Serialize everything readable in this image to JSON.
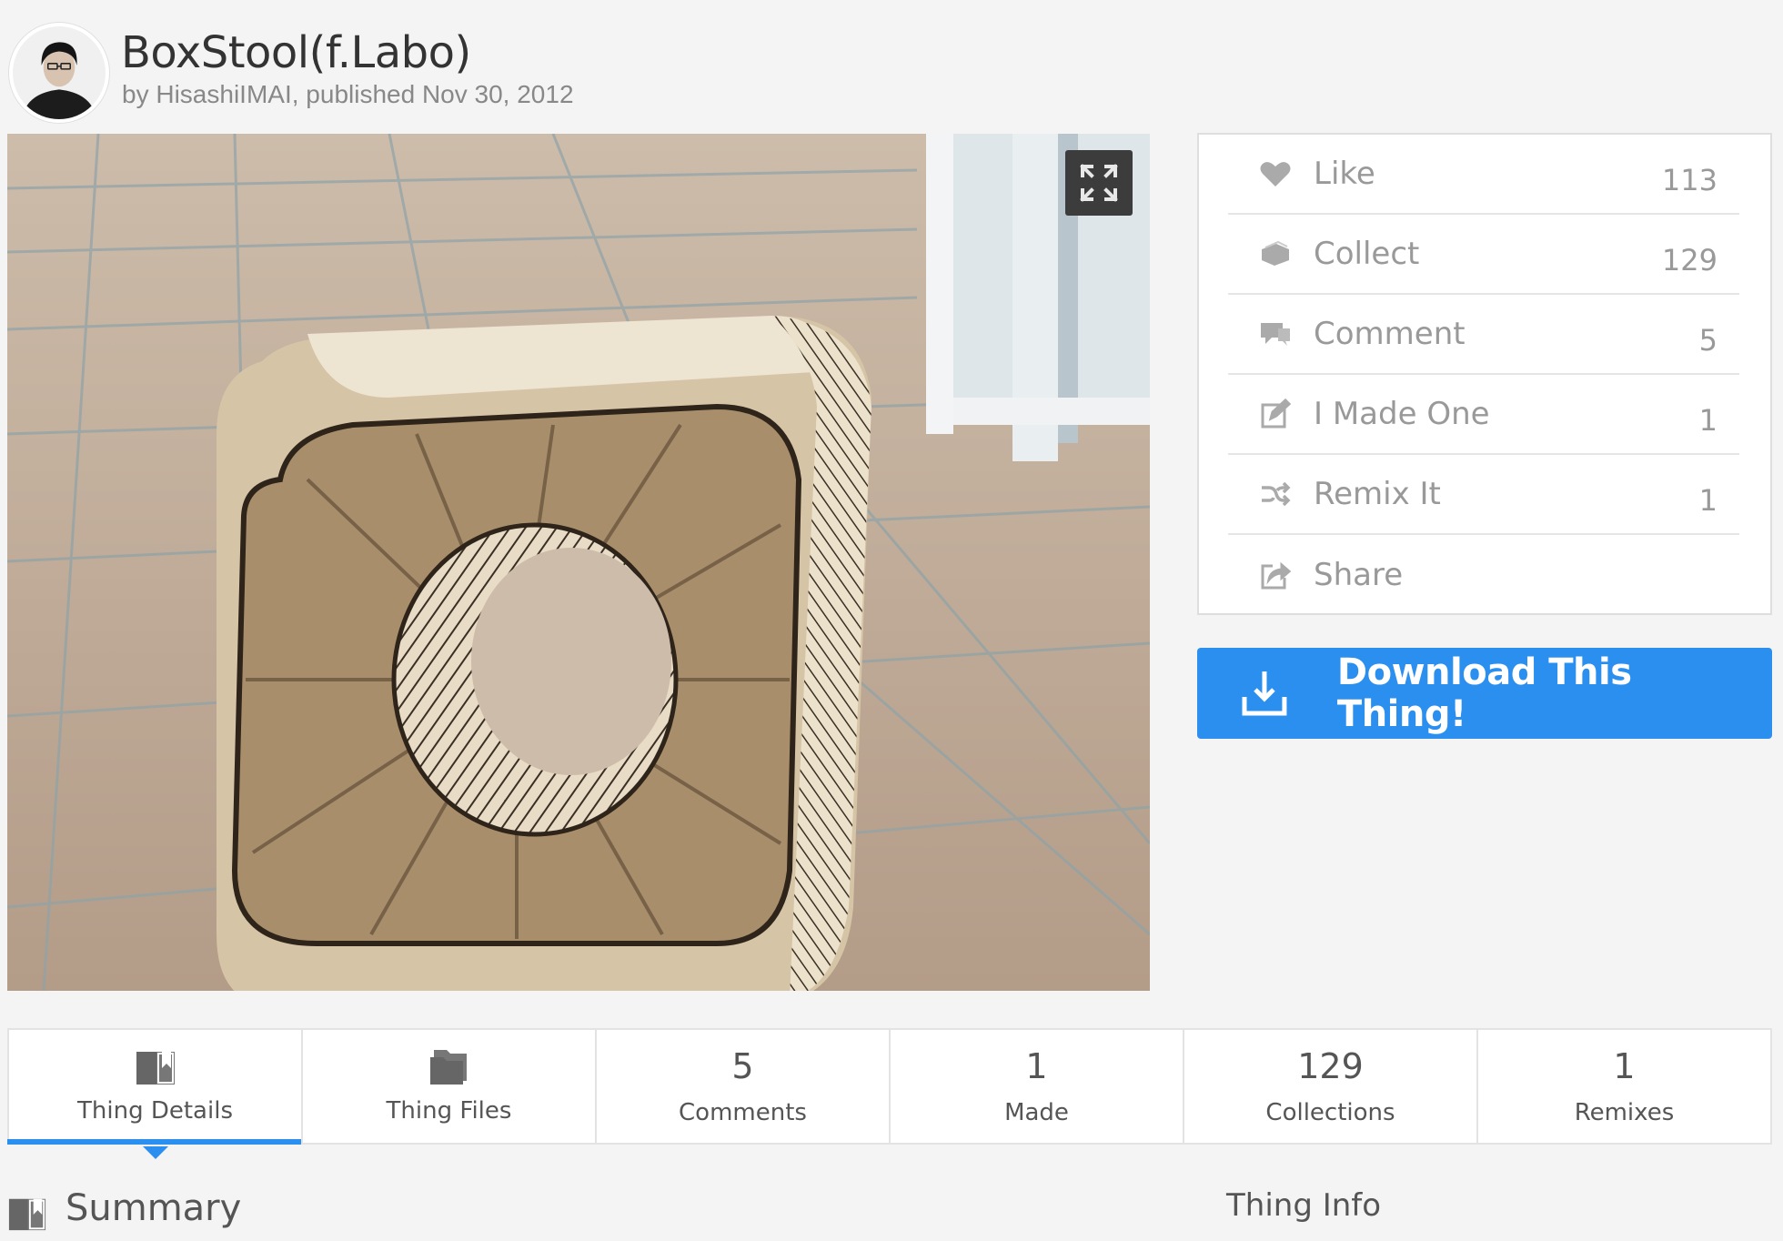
{
  "thing": {
    "title": "BoxStool(f.Labo)",
    "byline_prefix": "by ",
    "author": "HisashiIMAI",
    "published": ", published Nov 30, 2012"
  },
  "actions": [
    {
      "label": "Like",
      "count": "113",
      "icon": "heart-icon"
    },
    {
      "label": "Collect",
      "count": "129",
      "icon": "collect-icon"
    },
    {
      "label": "Comment",
      "count": "5",
      "icon": "comment-icon"
    },
    {
      "label": "I Made One",
      "count": "1",
      "icon": "made-icon"
    },
    {
      "label": "Remix It",
      "count": "1",
      "icon": "remix-icon"
    },
    {
      "label": "Share",
      "count": "",
      "icon": "share-icon"
    }
  ],
  "download": {
    "label": "Download This Thing!"
  },
  "tabs": [
    {
      "label": "Thing Details",
      "icon": "details-icon"
    },
    {
      "label": "Thing Files",
      "icon": "files-icon"
    },
    {
      "number": "5",
      "label": "Comments"
    },
    {
      "number": "1",
      "label": "Made"
    },
    {
      "number": "129",
      "label": "Collections"
    },
    {
      "number": "1",
      "label": "Remixes"
    }
  ],
  "sections": {
    "summary": "Summary",
    "thing_info": "Thing Info"
  },
  "colors": {
    "accent": "#2b8ff0",
    "muted_text": "#999999",
    "expand_button": "#3c3c3c"
  }
}
